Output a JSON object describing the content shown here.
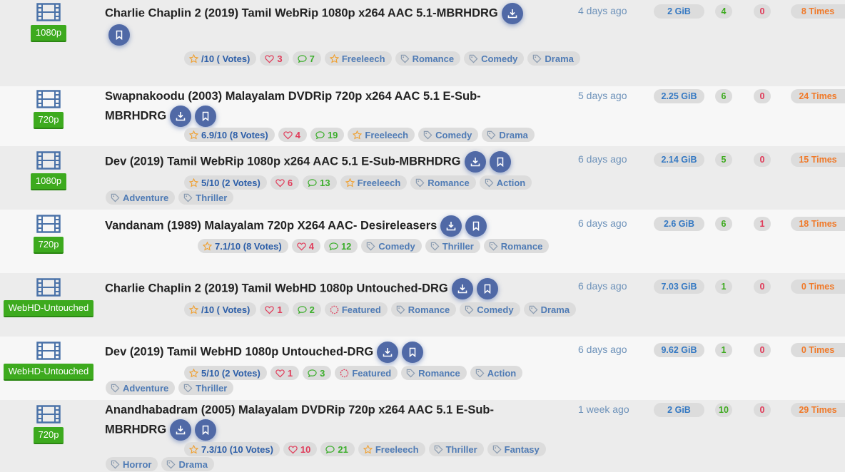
{
  "torrents": [
    {
      "category": "1080p",
      "title": "Charlie Chaplin 2 (2019) Tamil WebRip 1080p x264 AAC 5.1-MBRHDRG",
      "rating": "/10 ( Votes)",
      "likes": "3",
      "comments": "7",
      "status": "Freeleech",
      "genres": [
        "Romance",
        "Comedy",
        "Drama"
      ],
      "ago": "4 days ago",
      "size": "2 GiB",
      "seeders": "4",
      "leechers": "0",
      "completed": "8 Times"
    },
    {
      "category": "720p",
      "title": "Swapnakoodu (2003) Malayalam DVDRip 720p x264 AAC 5.1 E-Sub-MBRHDRG",
      "rating": "6.9/10 (8 Votes)",
      "likes": "4",
      "comments": "19",
      "status": "Freeleech",
      "genres": [
        "Comedy",
        "Drama"
      ],
      "ago": "5 days ago",
      "size": "2.25 GiB",
      "seeders": "6",
      "leechers": "0",
      "completed": "24 Times"
    },
    {
      "category": "1080p",
      "title": "Dev (2019) Tamil WebRip 1080p x264 AAC 5.1 E-Sub-MBRHDRG",
      "rating": "5/10 (2 Votes)",
      "likes": "6",
      "comments": "13",
      "status": "Freeleech",
      "genres": [
        "Romance",
        "Action",
        "Adventure",
        "Thriller"
      ],
      "ago": "6 days ago",
      "size": "2.14 GiB",
      "seeders": "5",
      "leechers": "0",
      "completed": "15 Times"
    },
    {
      "category": "720p",
      "title": "Vandanam (1989) Malayalam 720p X264 AAC- Desireleasers",
      "rating": "7.1/10 (8 Votes)",
      "likes": "4",
      "comments": "12",
      "status": "",
      "genres": [
        "Comedy",
        "Thriller",
        "Romance"
      ],
      "ago": "6 days ago",
      "size": "2.6 GiB",
      "seeders": "6",
      "leechers": "1",
      "completed": "18 Times"
    },
    {
      "category": "WebHD-Untouched",
      "title": "Charlie Chaplin 2 (2019) Tamil WebHD 1080p Untouched-DRG",
      "rating": "/10 ( Votes)",
      "likes": "1",
      "comments": "2",
      "status": "Featured",
      "genres": [
        "Romance",
        "Comedy",
        "Drama"
      ],
      "ago": "6 days ago",
      "size": "7.03 GiB",
      "seeders": "1",
      "leechers": "0",
      "completed": "0 Times"
    },
    {
      "category": "WebHD-Untouched",
      "title": "Dev (2019) Tamil WebHD 1080p Untouched-DRG",
      "rating": "5/10 (2 Votes)",
      "likes": "1",
      "comments": "3",
      "status": "Featured",
      "genres": [
        "Romance",
        "Action",
        "Adventure",
        "Thriller"
      ],
      "ago": "6 days ago",
      "size": "9.62 GiB",
      "seeders": "1",
      "leechers": "0",
      "completed": "0 Times"
    },
    {
      "category": "720p",
      "title": "Anandhabadram (2005) Malayalam DVDRip 720p x264 AAC 5.1 E-Sub-MBRHDRG",
      "rating": "7.3/10 (10 Votes)",
      "likes": "10",
      "comments": "21",
      "status": "Freeleech",
      "genres": [
        "Thriller",
        "Fantasy",
        "Horror",
        "Drama"
      ],
      "ago": "1 week ago",
      "size": "2 GiB",
      "seeders": "10",
      "leechers": "0",
      "completed": "29 Times"
    }
  ],
  "icons": {
    "category": "film-icon",
    "download": "download-icon",
    "bookmark": "bookmark-icon",
    "rating": "star-icon",
    "likes": "heart-icon",
    "comments": "comment-icon",
    "freeleech": "star-icon",
    "featured": "circle-icon",
    "genre": "tag-icon"
  },
  "colors": {
    "resolution_badge": "#3daa1e",
    "action_button": "#5069a6",
    "size": "#3579c3",
    "seeders": "#3daa1e",
    "leechers": "#e03c5a",
    "completed": "#f07a2a",
    "timestamp": "#6c91b9"
  }
}
